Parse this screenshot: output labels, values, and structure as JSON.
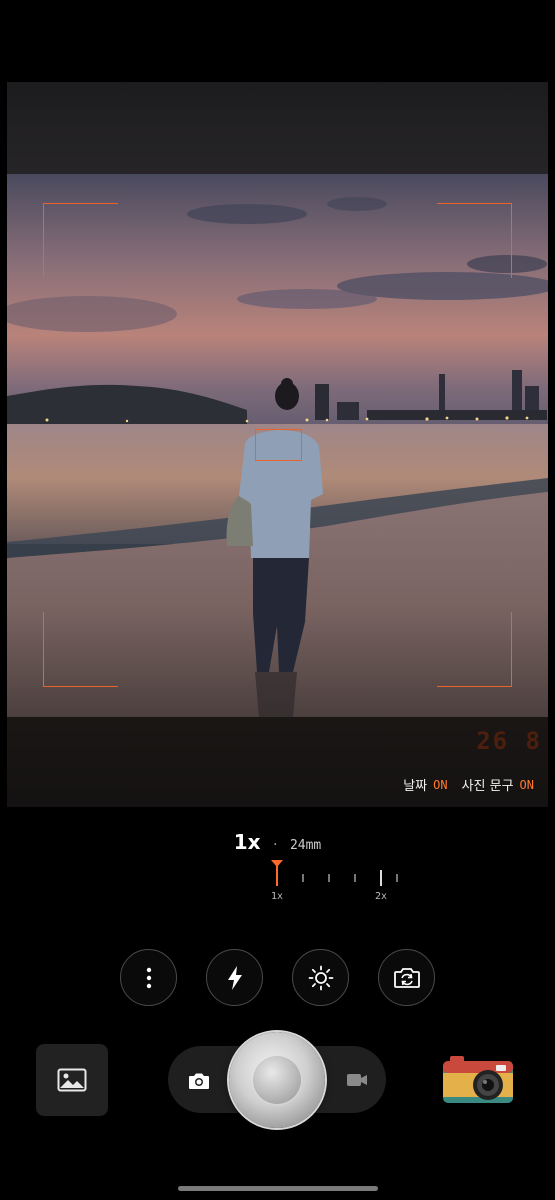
{
  "viewfinder": {
    "date_stamp": "26 8",
    "toggles": [
      {
        "label": "날짜",
        "state": "ON"
      },
      {
        "label": "사진 문구",
        "state": "ON"
      }
    ],
    "accent_color": "#e8642c"
  },
  "zoom": {
    "value": "1x",
    "separator": "·",
    "focal_length": "24mm",
    "scale_labels": [
      "1x",
      "2x"
    ],
    "current_level": 1
  },
  "controls": [
    {
      "name": "more-options",
      "icon": "more-vertical-icon"
    },
    {
      "name": "flash",
      "icon": "flash-icon"
    },
    {
      "name": "brightness",
      "icon": "brightness-icon"
    },
    {
      "name": "switch-camera",
      "icon": "camera-switch-icon"
    }
  ],
  "bottom_bar": {
    "gallery_icon": "image-icon",
    "modes": [
      {
        "name": "photo",
        "icon": "camera-icon"
      },
      {
        "name": "video",
        "icon": "video-icon"
      }
    ],
    "shutter": "shutter-button",
    "camera_style_icon": "retro-camera-icon"
  }
}
